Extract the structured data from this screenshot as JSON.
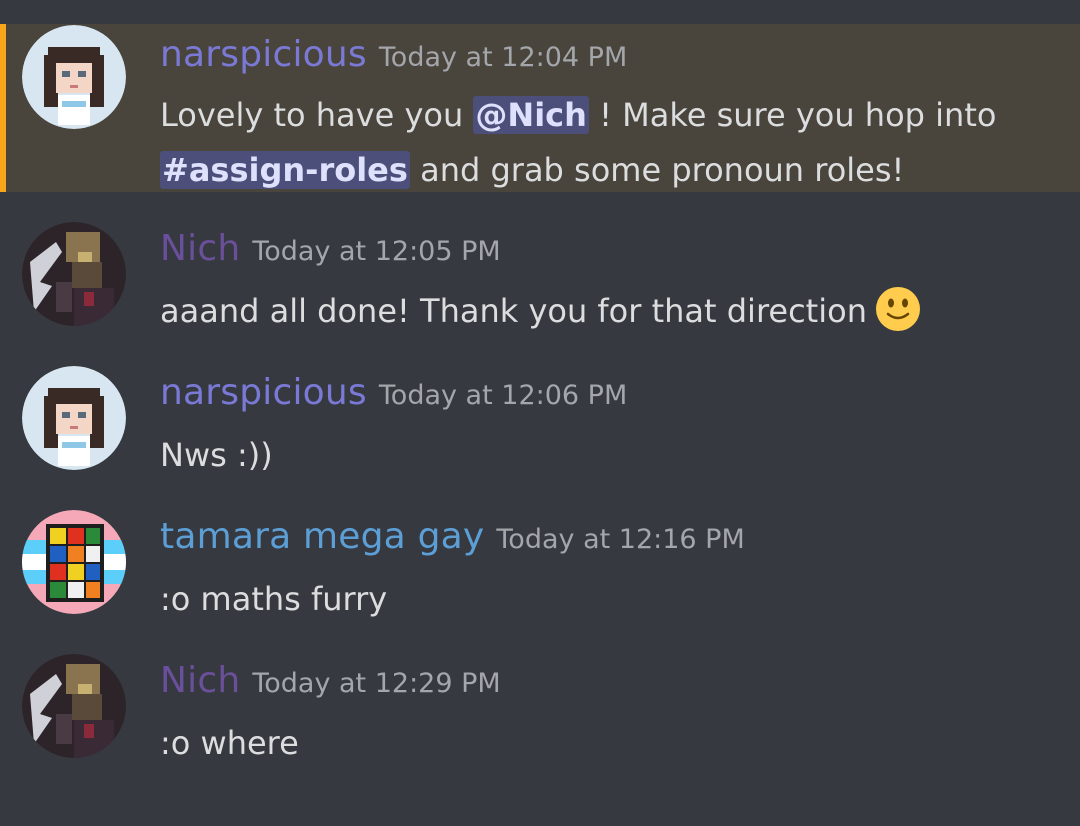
{
  "colors": {
    "background": "#36393f",
    "highlight_background": "#49443c",
    "highlight_bar": "#faa61a",
    "narspicious": "#7a7ad6",
    "nich": "#6a4f9a",
    "tamara": "#5c9fd6",
    "timestamp": "#a3a6aa",
    "text": "#dcddde",
    "mention_bg": "#4c4f7a"
  },
  "messages": [
    {
      "author": "narspicious",
      "timestamp": "Today at 12:04 PM",
      "highlighted": true,
      "avatar": "pixel-girl-avatar",
      "text_before": "Lovely to have you ",
      "mention_user": "@Nich",
      "text_middle": " ! Make sure you hop into",
      "mention_channel": "#assign-roles",
      "text_after": " and grab some pronoun roles!"
    },
    {
      "author": "Nich",
      "timestamp": "Today at 12:05 PM",
      "avatar": "dark-creature-avatar",
      "text": "aaand all done! Thank you for that direction",
      "emoji": "slightly-smiling-face-emoji"
    },
    {
      "author": "narspicious",
      "timestamp": "Today at 12:06 PM",
      "avatar": "pixel-girl-avatar",
      "text": "Nws :))"
    },
    {
      "author": "tamara mega gay",
      "timestamp": "Today at 12:16 PM",
      "avatar": "rubiks-cube-avatar",
      "text": ":o maths furry"
    },
    {
      "author": "Nich",
      "timestamp": "Today at 12:29 PM",
      "avatar": "dark-creature-avatar",
      "text": ":o where"
    }
  ]
}
